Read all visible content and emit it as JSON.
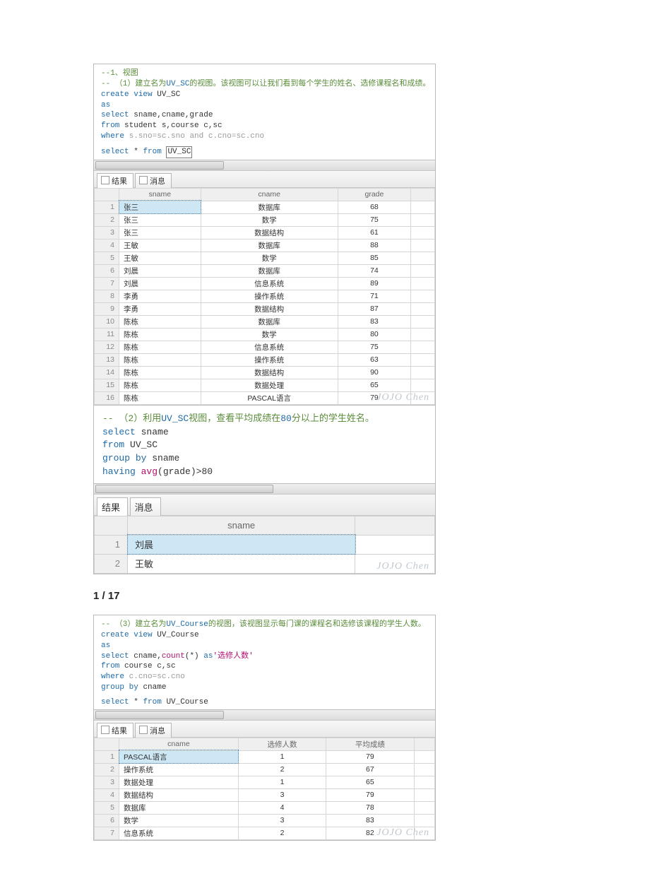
{
  "page_label": "1 / 17",
  "watermark": "JOJO Chen",
  "panel1": {
    "sql": {
      "c1": "--1、视图",
      "c2_pre": "-- （1）建立名为",
      "c2_uv": "UV_SC",
      "c2_post": "的视图。该视图可以让我们看到每个学生的姓名、选修课程名和成绩。",
      "l1a": "create",
      "l1b": "view",
      "l1c": "UV_SC",
      "l2": "as",
      "l3a": "select",
      "l3b": "sname,cname,grade",
      "l4a": "from",
      "l4b": "student s,course c,sc",
      "l5a": "where",
      "l5b": "s.sno=sc.sno and c.cno=sc.cno",
      "l6a": "select",
      "l6b": "*",
      "l6c": "from",
      "l6d": "UV_SC"
    },
    "tabs": {
      "results": "结果",
      "messages": "消息"
    },
    "columns": [
      "sname",
      "cname",
      "grade"
    ],
    "rows": [
      [
        "张三",
        "数据库",
        "68"
      ],
      [
        "张三",
        "数学",
        "75"
      ],
      [
        "张三",
        "数据结构",
        "61"
      ],
      [
        "王敏",
        "数据库",
        "88"
      ],
      [
        "王敏",
        "数学",
        "85"
      ],
      [
        "刘晨",
        "数据库",
        "74"
      ],
      [
        "刘晨",
        "信息系统",
        "89"
      ],
      [
        "李勇",
        "操作系统",
        "71"
      ],
      [
        "李勇",
        "数据结构",
        "87"
      ],
      [
        "陈栋",
        "数据库",
        "83"
      ],
      [
        "陈栋",
        "数学",
        "80"
      ],
      [
        "陈栋",
        "信息系统",
        "75"
      ],
      [
        "陈栋",
        "操作系统",
        "63"
      ],
      [
        "陈栋",
        "数据结构",
        "90"
      ],
      [
        "陈栋",
        "数据处理",
        "65"
      ],
      [
        "陈栋",
        "PASCAL语言",
        "79"
      ]
    ]
  },
  "panel2": {
    "sql": {
      "c1_pre": "-- （2）利用",
      "c1_uv": "UV_SC",
      "c1_post": "视图，查看平均成绩在",
      "c1_num": "80",
      "c1_tail": "分以上的学生姓名。",
      "l1a": "select",
      "l1b": "sname",
      "l2a": "from",
      "l2b": "UV_SC",
      "l3a": "group",
      "l3b": "by",
      "l3c": "sname",
      "l4a": "having",
      "l4b": "avg",
      "l4c": "(grade)>80"
    },
    "tabs": {
      "results": "结果",
      "messages": "消息"
    },
    "columns": [
      "sname"
    ],
    "rows": [
      [
        "刘晨"
      ],
      [
        "王敏"
      ]
    ]
  },
  "panel3": {
    "sql": {
      "c1_pre": "-- （3）建立名为",
      "c1_uv": "UV_Course",
      "c1_post": "的视图，该视图显示每门课的课程名和选修该课程的学生人数。",
      "l1a": "create",
      "l1b": "view",
      "l1c": "UV_Course",
      "l2": "as",
      "l3a": "select",
      "l3b": "cname,",
      "l3c": "count",
      "l3d": "(*)",
      "l3e": "as",
      "l3f": "'选修人数'",
      "l4a": "from",
      "l4b": "course c,sc",
      "l5a": "where",
      "l5b": "c.cno=sc.cno",
      "l6a": "group",
      "l6b": "by",
      "l6c": "cname",
      "l7a": "select",
      "l7b": "*",
      "l7c": "from",
      "l7d": "UV_Course"
    },
    "tabs": {
      "results": "结果",
      "messages": "消息"
    },
    "columns": [
      "cname",
      "选修人数",
      "平均成绩"
    ],
    "rows": [
      [
        "PASCAL语言",
        "1",
        "79"
      ],
      [
        "操作系统",
        "2",
        "67"
      ],
      [
        "数据处理",
        "1",
        "65"
      ],
      [
        "数据结构",
        "3",
        "79"
      ],
      [
        "数据库",
        "4",
        "78"
      ],
      [
        "数学",
        "3",
        "83"
      ],
      [
        "信息系统",
        "2",
        "82"
      ]
    ]
  }
}
